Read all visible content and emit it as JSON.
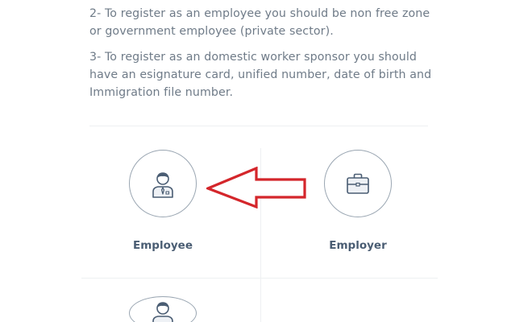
{
  "instructions": {
    "line2": "2- To register as an employee you should be non free zone or government employee (private sector).",
    "line3": "3- To register as an domestic worker sponsor you should have an esignature card, unified number, date of birth and Immigration file number."
  },
  "options": {
    "employee": {
      "label": "Employee",
      "icon": "employee-person-icon"
    },
    "employer": {
      "label": "Employer",
      "icon": "briefcase-icon"
    },
    "third": {
      "label": "",
      "icon": "person-icon"
    }
  },
  "annotation": {
    "arrow_color": "#d4262b",
    "points_to": "employee"
  },
  "colors": {
    "text": "#6f7b88",
    "label": "#4a5d73",
    "icon_stroke": "#4a5d73",
    "circle_border": "#9aa6b2",
    "divider": "#eef0f2"
  }
}
